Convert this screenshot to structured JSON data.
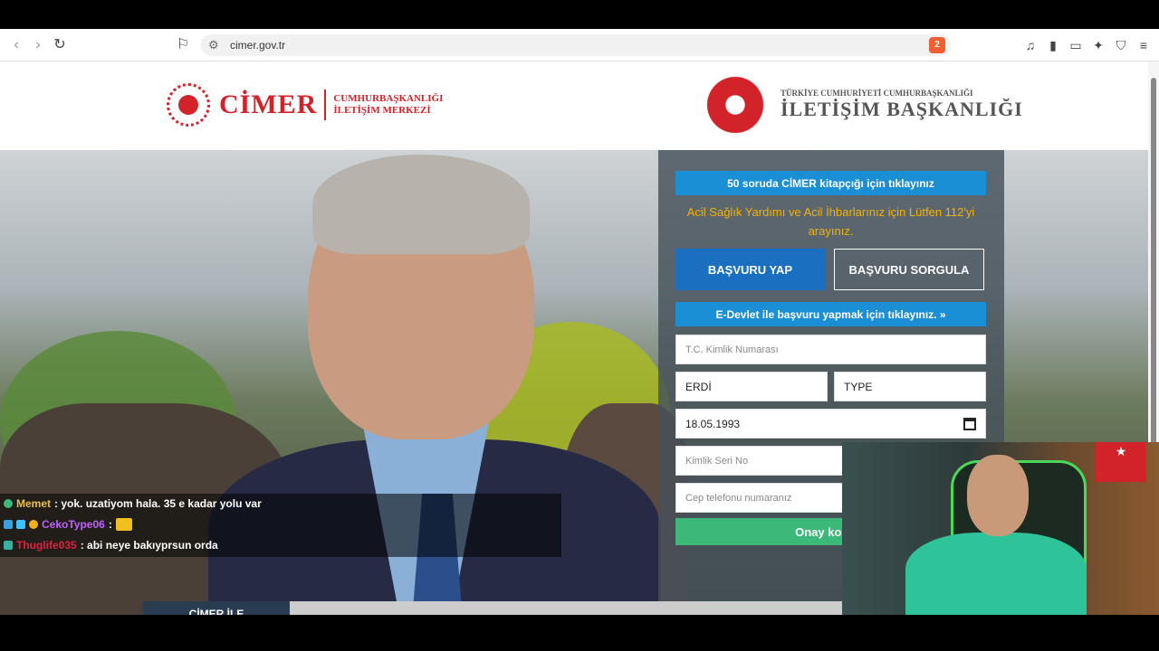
{
  "browser": {
    "url": "cimer.gov.tr",
    "brave_badge": "2"
  },
  "header": {
    "cimer_word": "CİMER",
    "cimer_sub_line1": "CUMHURBAŞKANLIĞI",
    "cimer_sub_line2": "İLETİŞİM MERKEZİ",
    "ib_small": "TÜRKİYE CUMHURİYETİ CUMHURBAŞKANLIĞI",
    "ib_big": "İLETİŞİM BAŞKANLIĞI"
  },
  "form": {
    "kitap_button": "50 soruda CİMER kitapçığı için tıklayınız",
    "warning": "Acil Sağlık Yardımı ve Acil İhbarlarınız için Lütfen 112'yi arayınız.",
    "tab_yap": "BAŞVURU YAP",
    "tab_sorgula": "BAŞVURU SORGULA",
    "edevlet_button": "E-Devlet ile başvuru yapmak için tıklayınız. »",
    "tc_placeholder": "T.C. Kimlik Numarası",
    "first_name_value": "ERDİ",
    "last_name_value": "TYPE",
    "birth_date_value": "18.05.1993",
    "serial_placeholder": "Kimlik Seri No",
    "phone_placeholder": "Cep telefonu numaranız",
    "onay_button": "Onay kodu g"
  },
  "chat": {
    "messages": [
      {
        "user": "Memet",
        "text": ": yok. uzatiyom hala. 35 e kadar yolu var",
        "color": "#e8c04a"
      },
      {
        "user": "CekoType06",
        "text": ":",
        "color": "#c060ff"
      },
      {
        "user": "Thuglife035",
        "text": ": abi neye bakıyprsun orda",
        "color": "#e02040"
      }
    ]
  },
  "bottom_tab": "CİMER İLE",
  "colors": {
    "cimer_red": "#d3232a",
    "button_blue": "#1a8fd6",
    "tab_blue": "#1a6fc0",
    "onay_green": "#3cb878",
    "warning_yellow": "#f5b300"
  }
}
